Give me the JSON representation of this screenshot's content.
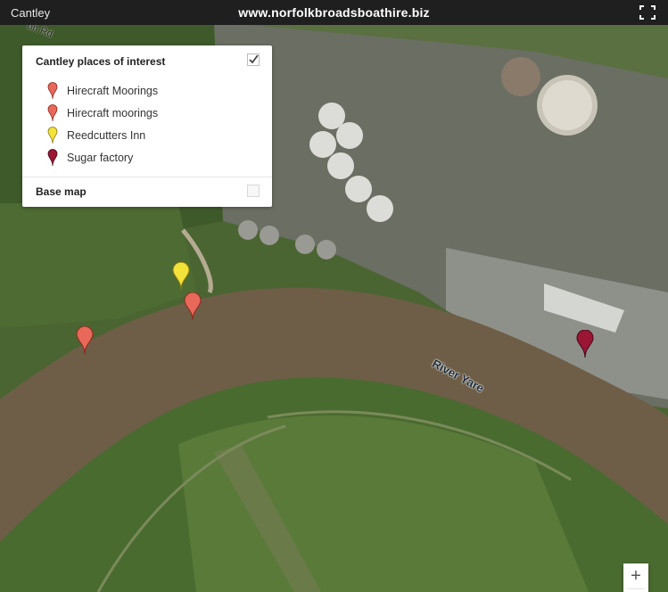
{
  "topbar": {
    "title": "Cantley",
    "url": "www.norfolkbroadsboathire.biz"
  },
  "legend": {
    "heading": "Cantley places of interest",
    "items": [
      {
        "label": "Hirecraft Moorings",
        "color": "#e8685a"
      },
      {
        "label": "Hirecraft moorings",
        "color": "#e8685a"
      },
      {
        "label": "Reedcutters Inn",
        "color": "#f2e23a"
      },
      {
        "label": "Sugar factory",
        "color": "#9b1535"
      }
    ],
    "base_map": "Base map"
  },
  "map_labels": {
    "river": "River Yare",
    "road": "on Rd"
  },
  "zoom": {
    "in": "+",
    "out": "−"
  },
  "colors": {
    "topbar": "#1f1f1f",
    "river": "#6e5e47",
    "field": "#4f6a35"
  }
}
